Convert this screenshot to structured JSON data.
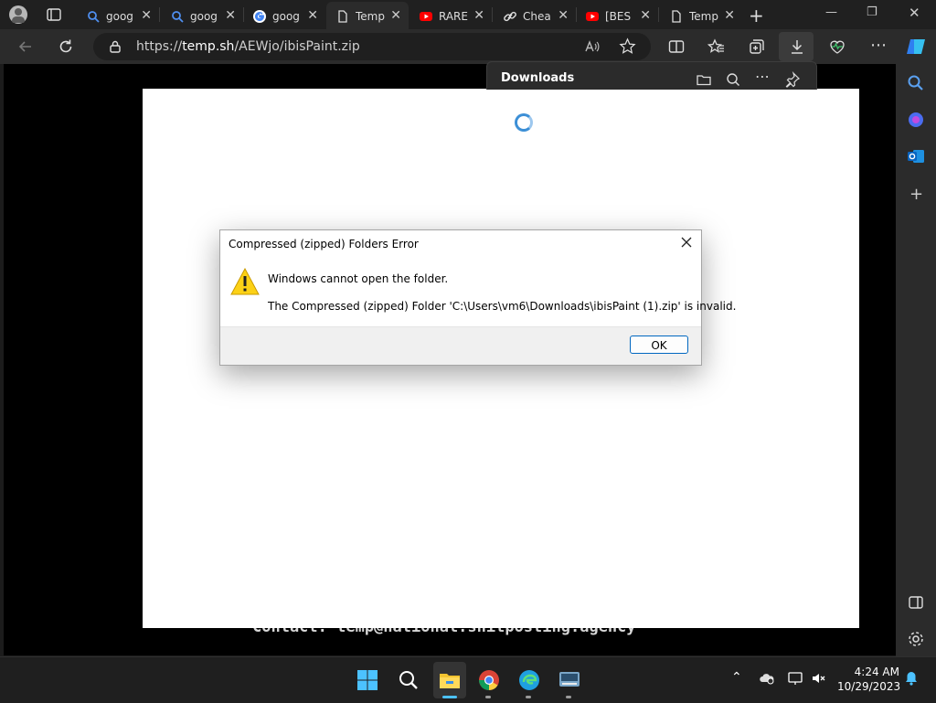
{
  "browser": {
    "tabs": [
      {
        "title": "goog",
        "icon": "search-icon"
      },
      {
        "title": "goog",
        "icon": "search-icon"
      },
      {
        "title": "goog",
        "icon": "google-icon"
      },
      {
        "title": "Temp",
        "icon": "page-icon",
        "active": true
      },
      {
        "title": "RARE",
        "icon": "youtube-icon"
      },
      {
        "title": "Chea",
        "icon": "link-icon"
      },
      {
        "title": "[BES",
        "icon": "youtube-icon"
      },
      {
        "title": "Temp",
        "icon": "page-icon"
      }
    ],
    "url": {
      "prefix": "https://",
      "host": "temp.sh",
      "path": "/AEWjo/ibisPaint.zip"
    }
  },
  "downloads_panel": {
    "title": "Downloads"
  },
  "page": {
    "contact": "Contact: temp@national.shitposting.agency"
  },
  "dialog": {
    "title": "Compressed (zipped) Folders Error",
    "message1": "Windows cannot open the folder.",
    "message2": "The Compressed (zipped) Folder 'C:\\Users\\vm6\\Downloads\\ibisPaint (1).zip' is invalid.",
    "ok_label": "OK"
  },
  "taskbar": {
    "time": "4:24 AM",
    "date": "10/29/2023"
  },
  "colors": {
    "accent": "#0067c0",
    "spinner": "#3c8fd6",
    "youtube": "#ff0000"
  }
}
